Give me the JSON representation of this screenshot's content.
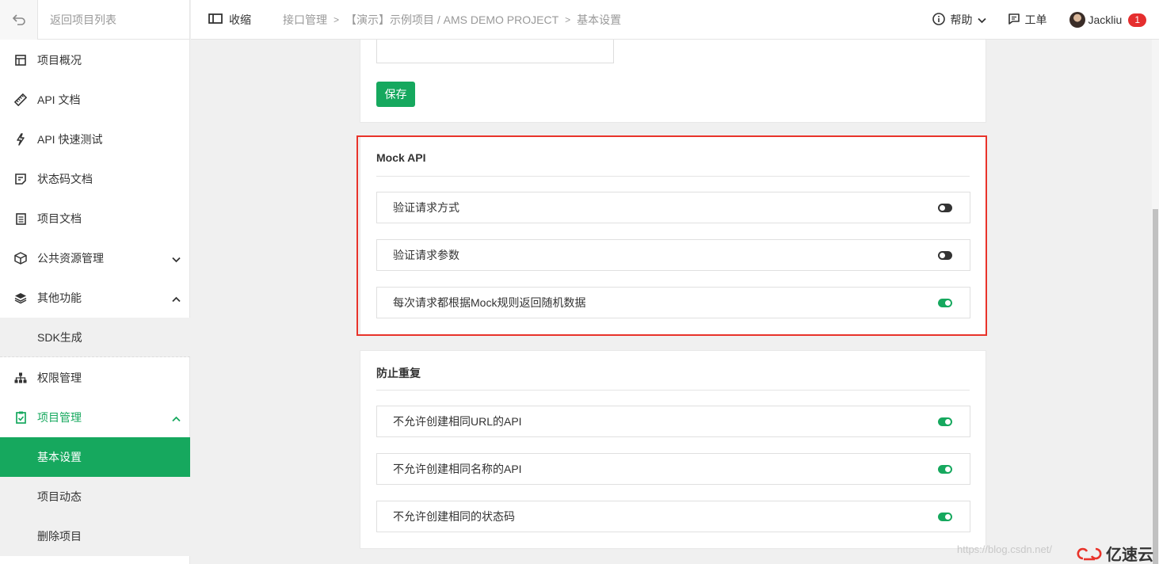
{
  "sidebar": {
    "back_label": "返回项目列表",
    "items": [
      {
        "label": "项目概况",
        "icon": "dashboard-icon"
      },
      {
        "label": "API 文档",
        "icon": "ruler-icon"
      },
      {
        "label": "API 快速测试",
        "icon": "lightning-icon"
      },
      {
        "label": "状态码文档",
        "icon": "note-icon"
      },
      {
        "label": "项目文档",
        "icon": "document-icon"
      },
      {
        "label": "公共资源管理",
        "icon": "cube-icon"
      },
      {
        "label": "其他功能",
        "icon": "layers-icon"
      },
      {
        "label": "SDK生成"
      },
      {
        "label": "权限管理",
        "icon": "hierarchy-icon"
      },
      {
        "label": "项目管理",
        "icon": "clipboard-check-icon"
      },
      {
        "label": "基本设置"
      },
      {
        "label": "项目动态"
      },
      {
        "label": "删除项目"
      }
    ]
  },
  "header": {
    "collapse_label": "收缩",
    "breadcrumb": [
      "接口管理",
      "【演示】示例项目 / AMS DEMO PROJECT",
      "基本设置"
    ],
    "help_label": "帮助",
    "ticket_label": "工单",
    "user_name": "Jackliu",
    "notification_count": "1"
  },
  "main": {
    "save_label": "保存",
    "mock_section": {
      "title": "Mock API",
      "options": [
        {
          "label": "验证请求方式",
          "enabled": false
        },
        {
          "label": "验证请求参数",
          "enabled": false
        },
        {
          "label": "每次请求都根据Mock规则返回随机数据",
          "enabled": true
        }
      ]
    },
    "dup_section": {
      "title": "防止重复",
      "options": [
        {
          "label": "不允许创建相同URL的API",
          "enabled": true
        },
        {
          "label": "不允许创建相同名称的API",
          "enabled": true
        },
        {
          "label": "不允许创建相同的状态码",
          "enabled": true
        }
      ]
    }
  },
  "watermark": "https://blog.csdn.net/",
  "brand": "亿速云",
  "colors": {
    "accent": "#16a85e",
    "highlight_border": "#e8332a",
    "badge": "#e52e2e"
  }
}
